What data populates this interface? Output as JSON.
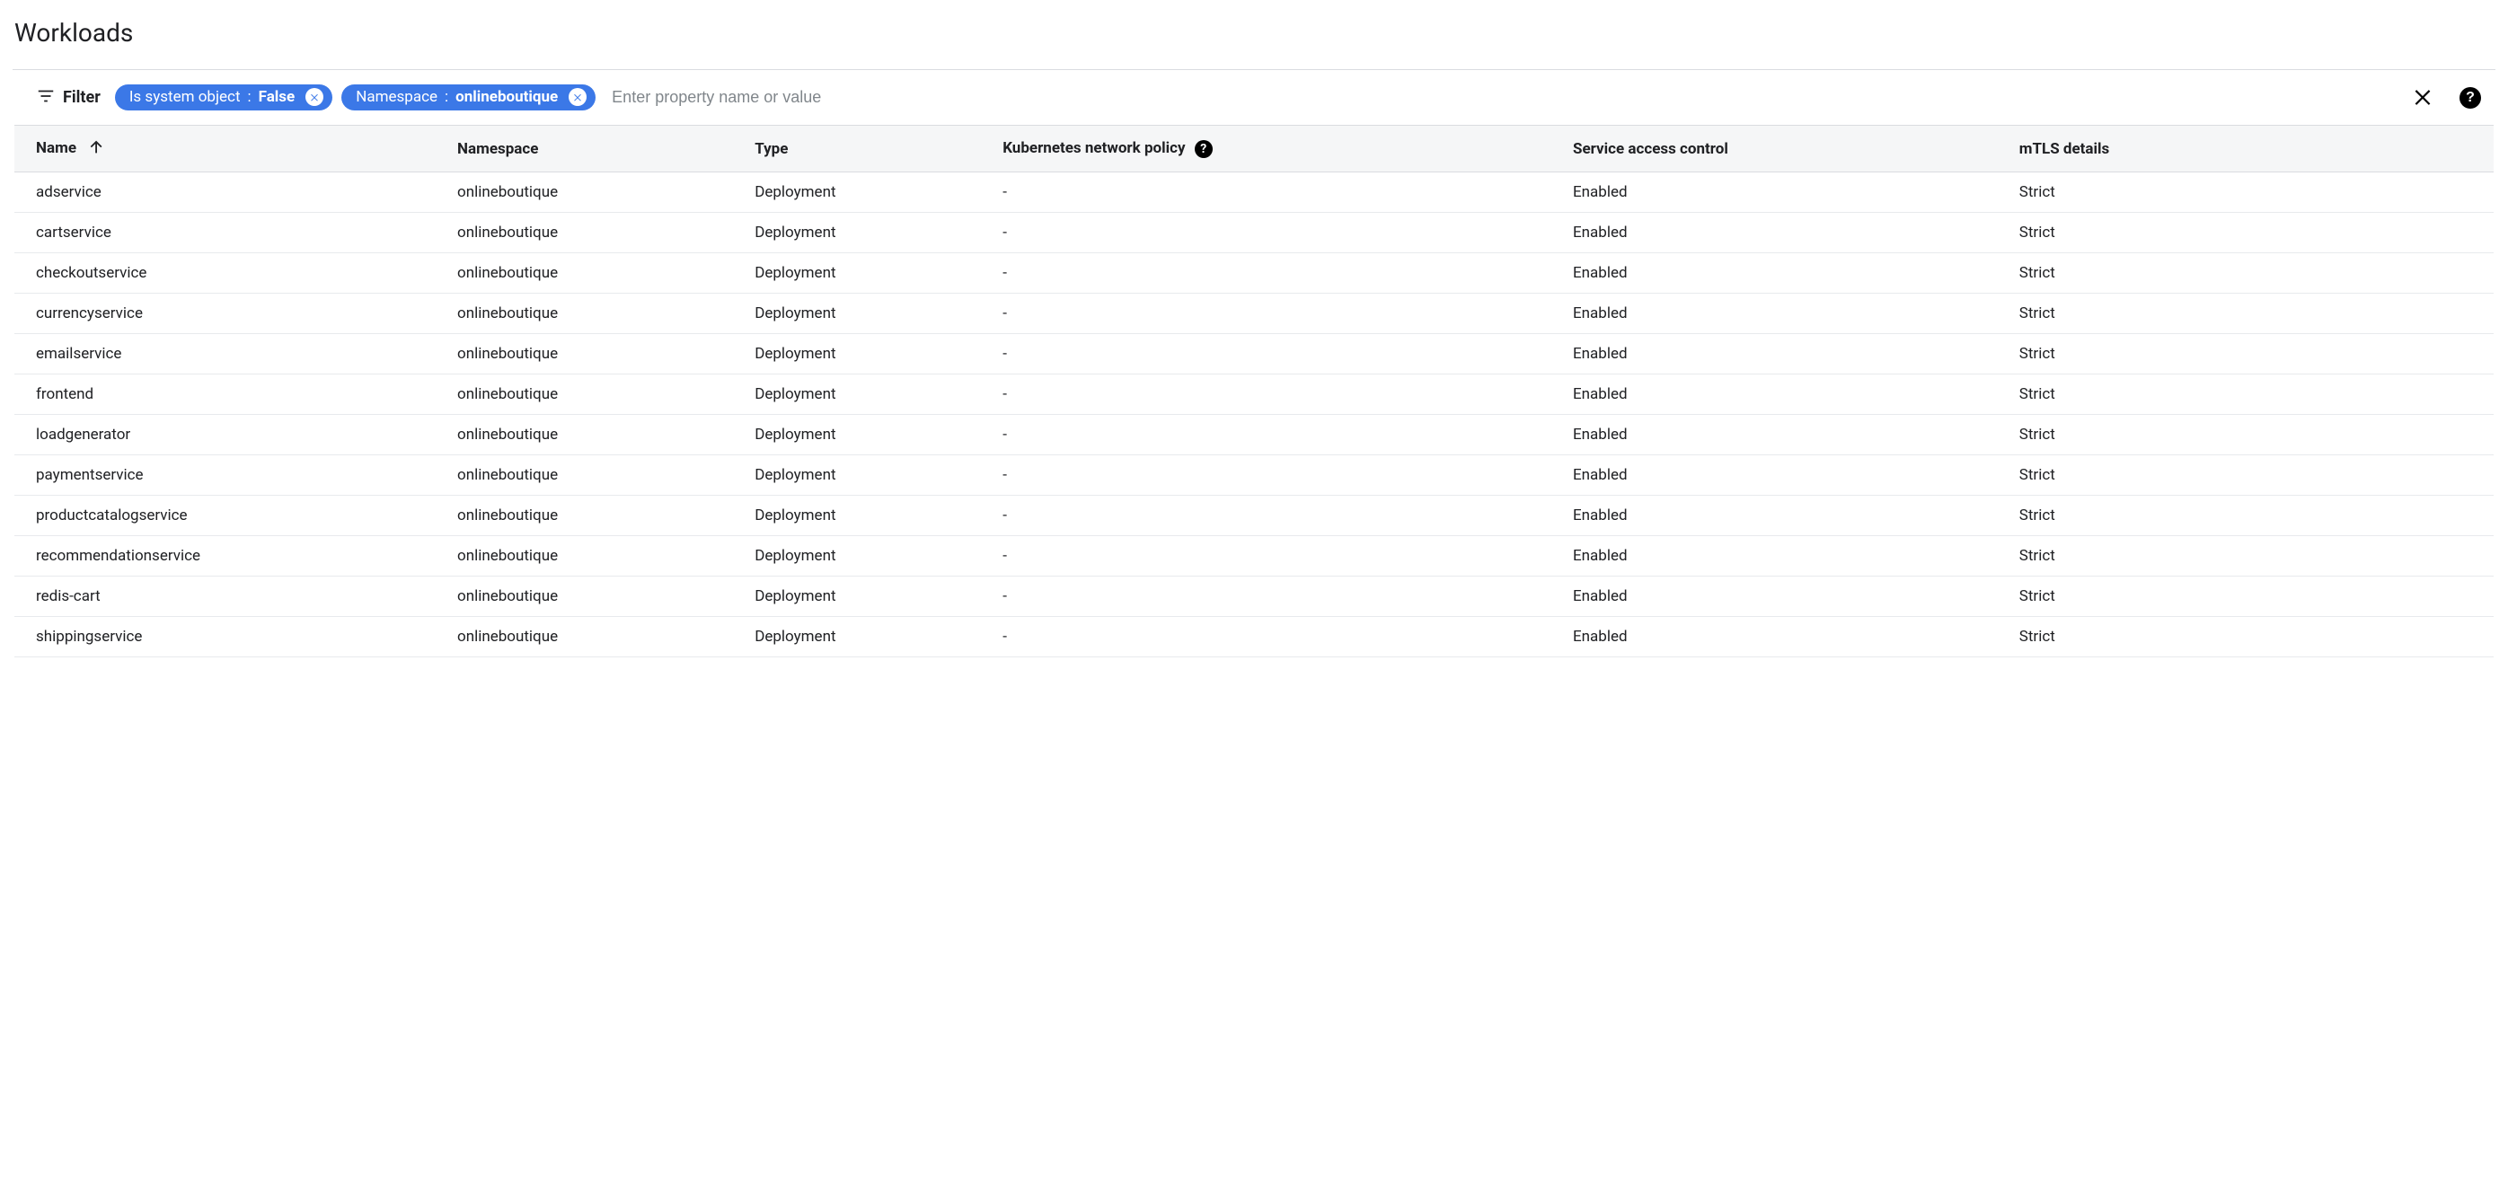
{
  "page": {
    "title": "Workloads"
  },
  "filter": {
    "label": "Filter",
    "chips": [
      {
        "key": "Is system object",
        "value": "False"
      },
      {
        "key": "Namespace",
        "value": "onlineboutique"
      }
    ],
    "placeholder": "Enter property name or value"
  },
  "columns": {
    "name": "Name",
    "namespace": "Namespace",
    "type": "Type",
    "k8s_network_policy": "Kubernetes network policy",
    "service_access_control": "Service access control",
    "mtls_details": "mTLS details"
  },
  "sort": {
    "column": "name",
    "direction": "asc"
  },
  "rows": [
    {
      "name": "adservice",
      "namespace": "onlineboutique",
      "type": "Deployment",
      "knp": "-",
      "sac": "Enabled",
      "mtls": "Strict"
    },
    {
      "name": "cartservice",
      "namespace": "onlineboutique",
      "type": "Deployment",
      "knp": "-",
      "sac": "Enabled",
      "mtls": "Strict"
    },
    {
      "name": "checkoutservice",
      "namespace": "onlineboutique",
      "type": "Deployment",
      "knp": "-",
      "sac": "Enabled",
      "mtls": "Strict"
    },
    {
      "name": "currencyservice",
      "namespace": "onlineboutique",
      "type": "Deployment",
      "knp": "-",
      "sac": "Enabled",
      "mtls": "Strict"
    },
    {
      "name": "emailservice",
      "namespace": "onlineboutique",
      "type": "Deployment",
      "knp": "-",
      "sac": "Enabled",
      "mtls": "Strict"
    },
    {
      "name": "frontend",
      "namespace": "onlineboutique",
      "type": "Deployment",
      "knp": "-",
      "sac": "Enabled",
      "mtls": "Strict"
    },
    {
      "name": "loadgenerator",
      "namespace": "onlineboutique",
      "type": "Deployment",
      "knp": "-",
      "sac": "Enabled",
      "mtls": "Strict"
    },
    {
      "name": "paymentservice",
      "namespace": "onlineboutique",
      "type": "Deployment",
      "knp": "-",
      "sac": "Enabled",
      "mtls": "Strict"
    },
    {
      "name": "productcatalogservice",
      "namespace": "onlineboutique",
      "type": "Deployment",
      "knp": "-",
      "sac": "Enabled",
      "mtls": "Strict"
    },
    {
      "name": "recommendationservice",
      "namespace": "onlineboutique",
      "type": "Deployment",
      "knp": "-",
      "sac": "Enabled",
      "mtls": "Strict"
    },
    {
      "name": "redis-cart",
      "namespace": "onlineboutique",
      "type": "Deployment",
      "knp": "-",
      "sac": "Enabled",
      "mtls": "Strict"
    },
    {
      "name": "shippingservice",
      "namespace": "onlineboutique",
      "type": "Deployment",
      "knp": "-",
      "sac": "Enabled",
      "mtls": "Strict"
    }
  ]
}
